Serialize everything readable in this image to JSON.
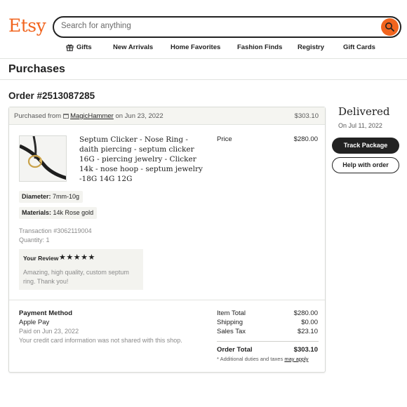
{
  "header": {
    "logo": "Etsy",
    "search_placeholder": "Search for anything",
    "nav": [
      "Gifts",
      "New Arrivals",
      "Home Favorites",
      "Fashion Finds",
      "Registry",
      "Gift Cards"
    ]
  },
  "page": {
    "title": "Purchases",
    "order_number": "Order #2513087285"
  },
  "order": {
    "purchased_from": "Purchased from",
    "shop_name": "MagicHammer",
    "purchase_date": "on Jun 23, 2022",
    "header_total": "$303.10",
    "item": {
      "title": "Septum Clicker - Nose Ring - daith piercing - septum clicker 16G - piercing jewelry - Clicker 14k - nose hoop - septum jewelry -18G 14G 12G",
      "price_label": "Price",
      "price": "$280.00",
      "diameter_label": "Diameter:",
      "diameter_value": "7mm-10g",
      "materials_label": "Materials:",
      "materials_value": "14k Rose gold",
      "transaction": "Transaction #3062119004",
      "quantity": "Quantity: 1"
    },
    "review": {
      "label": "Your Review",
      "stars": "★★★★★",
      "rating": 5,
      "text": "Amazing, high quality, custom septum ring. Thank you!"
    },
    "payment": {
      "title": "Payment Method",
      "method": "Apple Pay",
      "paid_on": "Paid on Jun 23, 2022",
      "note": "Your credit card information was not shared with this shop."
    },
    "summary": {
      "item_total_label": "Item Total",
      "item_total": "$280.00",
      "shipping_label": "Shipping",
      "shipping": "$0.00",
      "sales_tax_label": "Sales Tax",
      "sales_tax": "$23.10",
      "order_total_label": "Order Total",
      "order_total": "$303.10",
      "duties_note": "* Additional duties and taxes",
      "duties_link": "may apply"
    }
  },
  "delivery": {
    "status": "Delivered",
    "date": "On Jul 11, 2022",
    "track_button": "Track Package",
    "help_button": "Help with order"
  },
  "colors": {
    "brand": "#f1641e",
    "text": "#222222",
    "muted": "#8a8a8a",
    "panel": "#f3f3ef"
  }
}
